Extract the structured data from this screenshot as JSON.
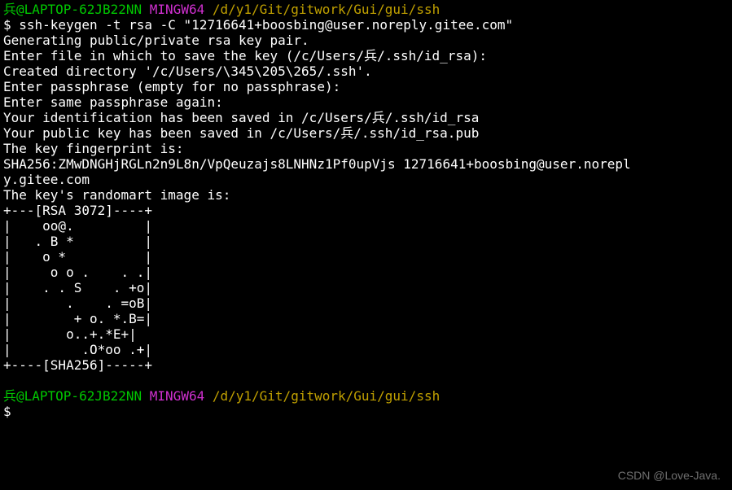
{
  "prompt1": {
    "user_host": "兵@LAPTOP-62JB22NN",
    "env": "MINGW64",
    "cwd": "/d/y1/Git/gitwork/Gui/gui/ssh",
    "sigil": "$ ",
    "command": "ssh-keygen -t rsa -C \"12716641+boosbing@user.noreply.gitee.com\""
  },
  "output": [
    "Generating public/private rsa key pair.",
    "Enter file in which to save the key (/c/Users/兵/.ssh/id_rsa):",
    "Created directory '/c/Users/\\345\\205\\265/.ssh'.",
    "Enter passphrase (empty for no passphrase):",
    "Enter same passphrase again:",
    "Your identification has been saved in /c/Users/兵/.ssh/id_rsa",
    "Your public key has been saved in /c/Users/兵/.ssh/id_rsa.pub",
    "The key fingerprint is:",
    "SHA256:ZMwDNGHjRGLn2n9L8n/VpQeuzajs8LNHNz1Pf0upVjs 12716641+boosbing@user.norepl",
    "y.gitee.com",
    "The key's randomart image is:",
    "+---[RSA 3072]----+",
    "|    oo@.         |",
    "|   . B *         |",
    "|    o *          |",
    "|     o o .    . .|",
    "|    . . S    . +o|",
    "|       .    . =oB|",
    "|        + o. *.B=|",
    "|       o..+.*E+|",
    "|         .O*oo .+|",
    "+----[SHA256]-----+"
  ],
  "blank_line": "",
  "prompt2": {
    "user_host": "兵@LAPTOP-62JB22NN",
    "env": "MINGW64",
    "cwd": "/d/y1/Git/gitwork/Gui/gui/ssh",
    "sigil": "$",
    "command": ""
  },
  "watermark": "CSDN @Love-Java."
}
